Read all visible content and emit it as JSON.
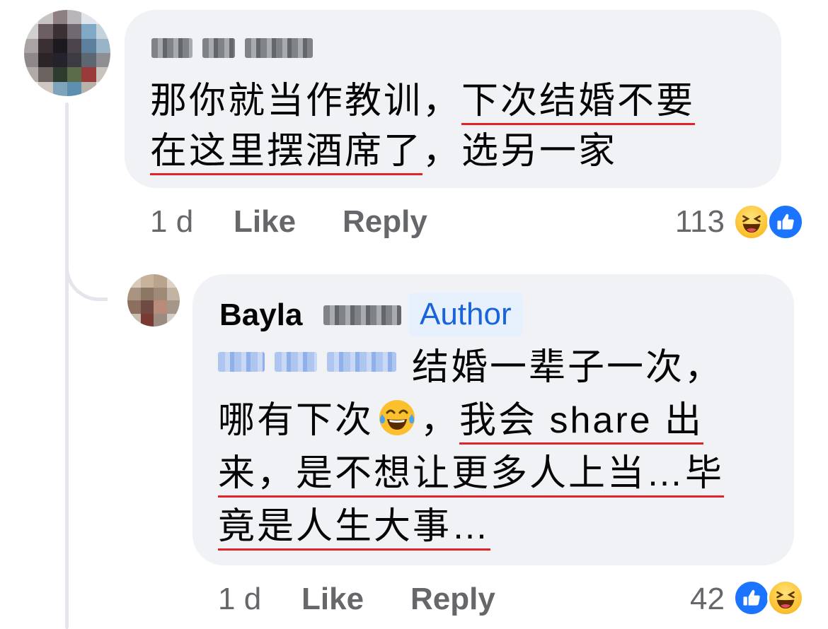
{
  "comment1": {
    "author_name": "Ka Bb Bau",
    "line1_plain": "那你就当作教训，",
    "line1_underlined": "下次结婚不要",
    "line2_underlined": "在这里摆酒席了",
    "line2_plain": "，选另一家",
    "timestamp": "1 d",
    "like_label": "Like",
    "reply_label": "Reply",
    "reaction_count": "113",
    "reactions": [
      "laugh-icon",
      "like-icon"
    ]
  },
  "reply1": {
    "author_name": "Bayla",
    "author_surname_blurred": "Cxxx",
    "author_badge": "Author",
    "mention": "Ka Bb Bau",
    "line1": "结婚一辈子一次，",
    "line2_plain_a": "哪有下次",
    "emoji": "tears-of-joy-icon",
    "line2_plain_b": "，",
    "line2_underlined": "我会 share 出",
    "line3_underlined": "来，是不想让更多人上当…毕",
    "line4_underlined": "竟是人生大事…",
    "timestamp": "1 d",
    "like_label": "Like",
    "reply_label": "Reply",
    "reaction_count": "42",
    "reactions": [
      "like-icon",
      "laugh-icon"
    ]
  },
  "colors": {
    "bubble": "#f0f2f5",
    "underline": "#e0242a",
    "author_badge_bg": "#e7f0fd",
    "author_badge_text": "#1a64d9",
    "like_blue": "#1a74ff"
  }
}
